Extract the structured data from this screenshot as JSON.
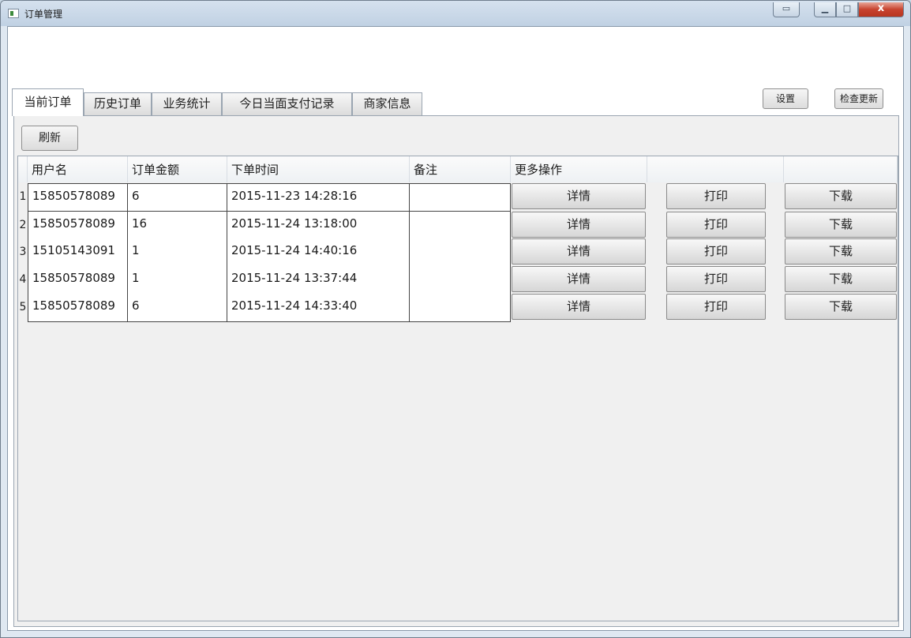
{
  "window": {
    "title": "订单管理",
    "extra_button": "",
    "minimize_icon": "minimize-icon",
    "maximize_icon": "maximize-icon",
    "close_icon": "close-icon",
    "close_glyph": "x"
  },
  "tabs": [
    {
      "label": "当前订单",
      "active": true
    },
    {
      "label": "历史订单",
      "active": false
    },
    {
      "label": "业务统计",
      "active": false
    },
    {
      "label": "今日当面支付记录",
      "active": false
    },
    {
      "label": "商家信息",
      "active": false
    }
  ],
  "toolbar": {
    "settings_label": "设置",
    "check_update_label": "检查更新",
    "refresh_label": "刷新"
  },
  "table": {
    "columns": [
      "用户名",
      "订单金额",
      "下单时间",
      "备注",
      "更多操作",
      "",
      ""
    ],
    "rows": [
      {
        "num": "1",
        "user": "15850578089",
        "amount": "6",
        "time": "2015-11-23 14:28:16",
        "note": ""
      },
      {
        "num": "2",
        "user": "15850578089",
        "amount": "16",
        "time": "2015-11-24 13:18:00",
        "note": ""
      },
      {
        "num": "3",
        "user": "15105143091",
        "amount": "1",
        "time": "2015-11-24 14:40:16",
        "note": ""
      },
      {
        "num": "4",
        "user": "15850578089",
        "amount": "1",
        "time": "2015-11-24 13:37:44",
        "note": ""
      },
      {
        "num": "5",
        "user": "15850578089",
        "amount": "6",
        "time": "2015-11-24 14:33:40",
        "note": ""
      }
    ],
    "actions": {
      "detail": "详情",
      "print": "打印",
      "download": "下载"
    }
  }
}
